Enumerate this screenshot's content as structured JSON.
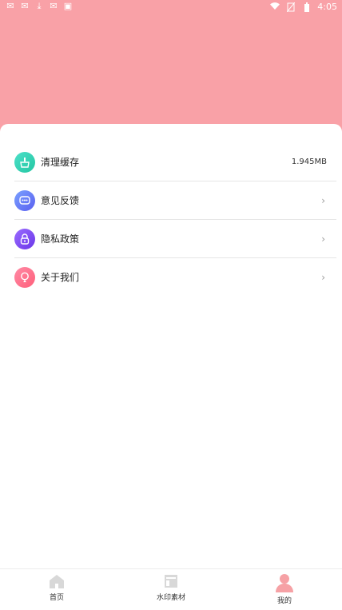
{
  "statusbar": {
    "time": "4:05",
    "left_icons": [
      "notification-icon",
      "notification-icon",
      "download-icon",
      "notification-icon",
      "app-icon"
    ],
    "right_icons": [
      "wifi-icon",
      "no-sim-icon",
      "battery-icon"
    ]
  },
  "menu": {
    "items": [
      {
        "label": "清理缓存",
        "value": "1.945MB",
        "icon": "broom-icon"
      },
      {
        "label": "意见反馈",
        "value": "",
        "icon": "chat-icon"
      },
      {
        "label": "隐私政策",
        "value": "",
        "icon": "lock-icon"
      },
      {
        "label": "关于我们",
        "value": "",
        "icon": "info-icon"
      }
    ],
    "chevron": "›"
  },
  "tabs": [
    {
      "label": "首页",
      "icon": "home-icon"
    },
    {
      "label": "水印素材",
      "icon": "layout-icon"
    },
    {
      "label": "我的",
      "icon": "user-icon"
    }
  ],
  "colors": {
    "header_bg": "#f9a1a7",
    "active_tab": "#f6a1a5",
    "inactive_tab": "#d8d8d8"
  }
}
